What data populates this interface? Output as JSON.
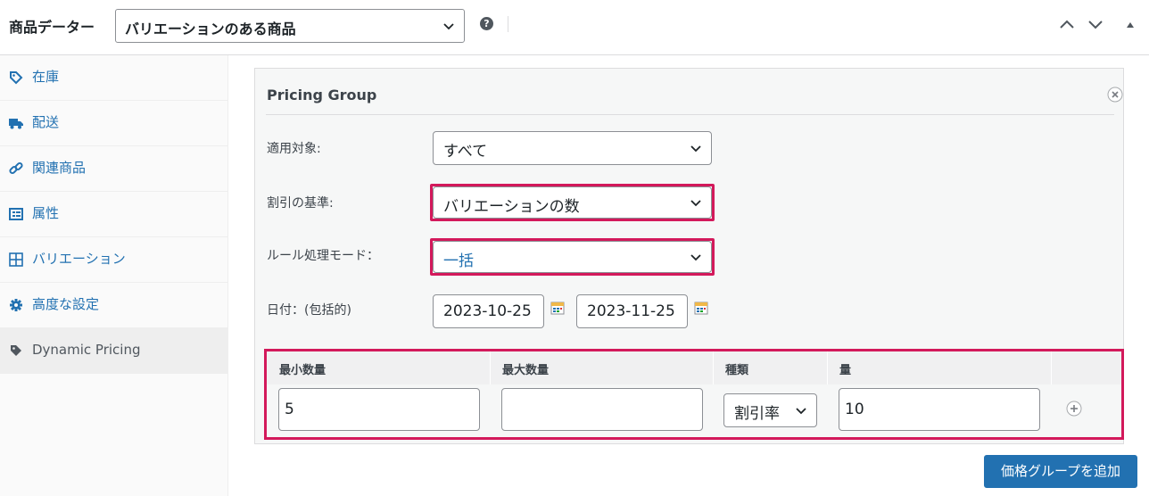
{
  "header": {
    "title": "商品データー",
    "product_type_value": "バリエーションのある商品",
    "help_glyph": "?"
  },
  "sidebar": {
    "items": [
      {
        "label": "在庫",
        "icon": "tag-icon"
      },
      {
        "label": "配送",
        "icon": "truck-icon"
      },
      {
        "label": "関連商品",
        "icon": "link-icon"
      },
      {
        "label": "属性",
        "icon": "list-icon"
      },
      {
        "label": "バリエーション",
        "icon": "grid-icon"
      },
      {
        "label": "高度な設定",
        "icon": "gear-icon"
      },
      {
        "label": "Dynamic Pricing",
        "icon": "tag-icon",
        "active": true
      }
    ]
  },
  "pricing_group": {
    "title": "Pricing Group",
    "applies_to": {
      "label": "適用対象:",
      "value": "すべて"
    },
    "discount_basis": {
      "label": "割引の基準:",
      "value": "バリエーションの数"
    },
    "rule_mode": {
      "label": "ルール処理モード：",
      "value": "一括"
    },
    "dates": {
      "label": "日付：(包括的)",
      "from": "2023-10-25",
      "to": "2023-11-25"
    },
    "rules_table": {
      "headers": [
        "最小数量",
        "最大数量",
        "種類",
        "量"
      ],
      "rows": [
        {
          "min": "5",
          "max": "",
          "type": "割引率",
          "amount": "10"
        }
      ]
    }
  },
  "add_group_button": "価格グループを追加",
  "colors": {
    "accent": "#2271b1",
    "highlight": "#d3195b"
  }
}
